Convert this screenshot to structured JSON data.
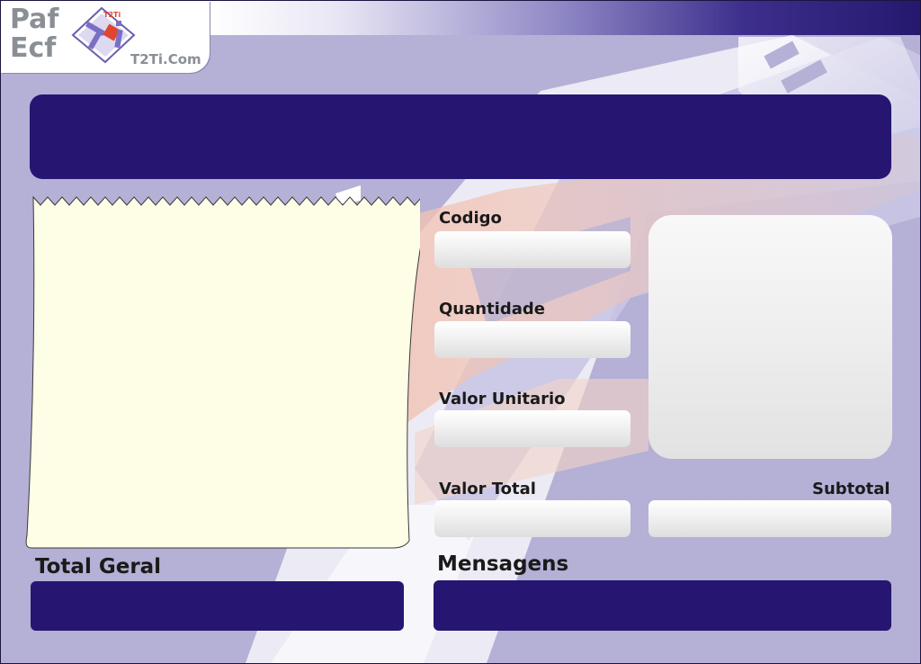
{
  "app": {
    "logo_line1": "Paf",
    "logo_line2": "Ecf",
    "logo_site": "T2Ti.Com",
    "logo_mark_letters": "T2Ti"
  },
  "form": {
    "codigo_label": "Codigo",
    "quantidade_label": "Quantidade",
    "valor_unitario_label": "Valor Unitario",
    "valor_total_label": "Valor Total",
    "subtotal_label": "Subtotal",
    "total_geral_label": "Total Geral",
    "mensagens_label": "Mensagens",
    "codigo_value": "",
    "quantidade_value": "",
    "valor_unitario_value": "",
    "valor_total_value": "",
    "subtotal_value": ""
  },
  "display": {
    "top_message": "",
    "total_geral_value": "",
    "mensagens_value": ""
  },
  "colors": {
    "background": "#b4b0d6",
    "dark_panel": "#261672",
    "receipt_paper": "#fefde6",
    "accent_salmon": "#f1c3b4"
  },
  "icons": {
    "logo": "t2ti-logo-icon"
  }
}
